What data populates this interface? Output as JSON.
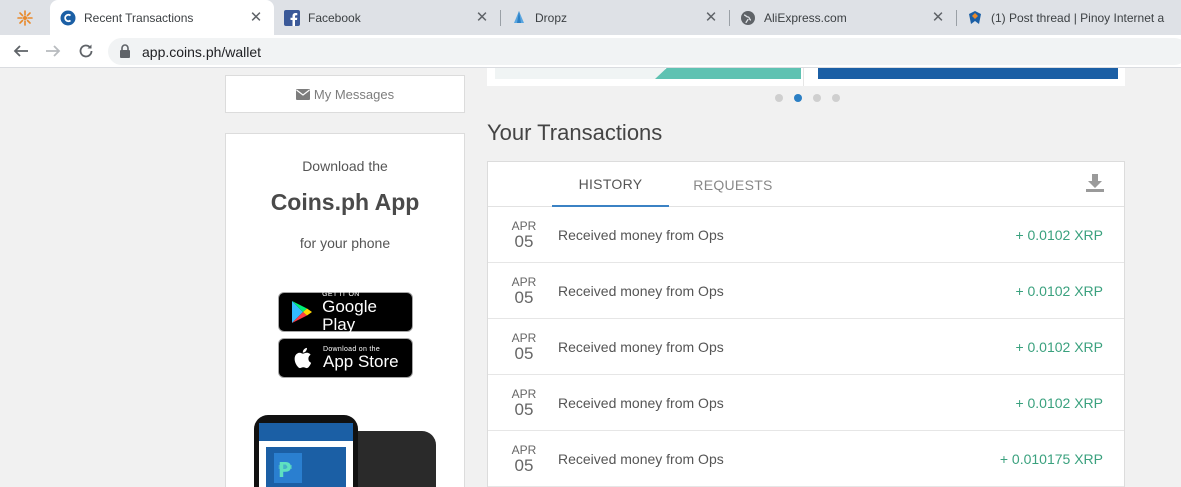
{
  "browser": {
    "tabs": [
      {
        "title": "Recent Transactions",
        "active": true
      },
      {
        "title": "Facebook",
        "active": false
      },
      {
        "title": "Dropz",
        "active": false
      },
      {
        "title": "AliExpress.com",
        "active": false
      },
      {
        "title": "(1) Post thread | Pinoy Internet a",
        "active": false
      }
    ],
    "url": "app.coins.ph/wallet"
  },
  "sidebar": {
    "messages_label": "My Messages",
    "download_line1": "Download the",
    "download_app_name": "Coins.ph App",
    "download_line3": "for your phone",
    "google_play": {
      "small": "GET IT ON",
      "big": "Google Play"
    },
    "app_store": {
      "small": "Download on the",
      "big": "App Store"
    }
  },
  "transactions": {
    "heading": "Your Transactions",
    "tabs": [
      {
        "label": "HISTORY",
        "active": true
      },
      {
        "label": "REQUESTS",
        "active": false
      }
    ],
    "rows": [
      {
        "month": "APR",
        "day": "05",
        "description": "Received money from Ops",
        "amount": "+ 0.0102 XRP"
      },
      {
        "month": "APR",
        "day": "05",
        "description": "Received money from Ops",
        "amount": "+ 0.0102 XRP"
      },
      {
        "month": "APR",
        "day": "05",
        "description": "Received money from Ops",
        "amount": "+ 0.0102 XRP"
      },
      {
        "month": "APR",
        "day": "05",
        "description": "Received money from Ops",
        "amount": "+ 0.0102 XRP"
      },
      {
        "month": "APR",
        "day": "05",
        "description": "Received money from Ops",
        "amount": "+ 0.010175 XRP"
      }
    ]
  },
  "carousel": {
    "count": 4,
    "active_index": 1
  },
  "colors": {
    "accent": "#3b82c4",
    "positive": "#3aa17e",
    "teal": "#5fc2b2",
    "navy": "#1b5fa5"
  }
}
